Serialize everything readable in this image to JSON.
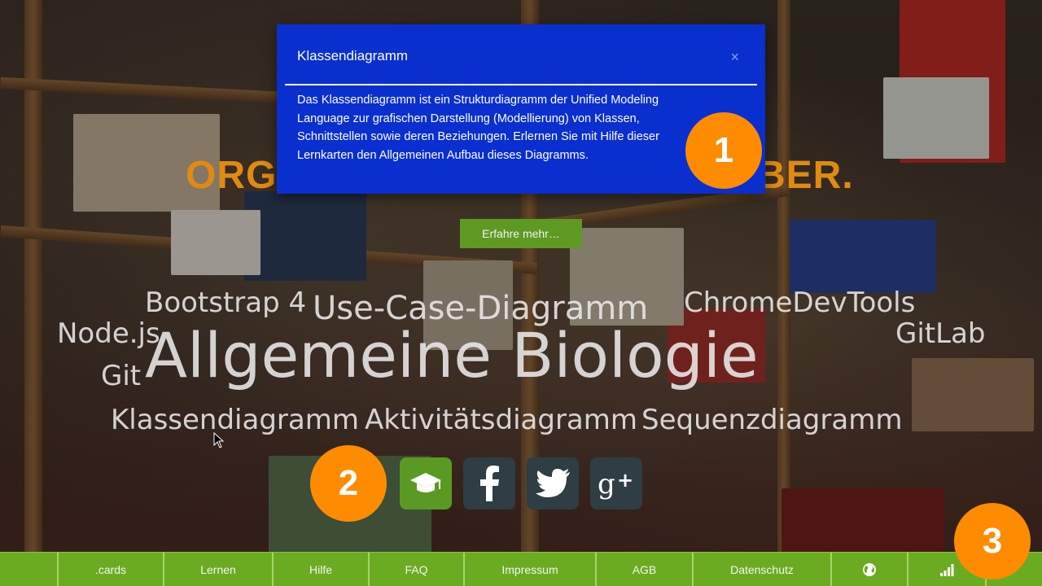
{
  "modal": {
    "title": "Klassendiagramm",
    "close_symbol": "×",
    "body": "Das Klassendiagramm ist ein Strukturdiagramm der Unified Modeling Language zur grafischen Darstellung (Modellierung) von Klassen, Schnittstellen sowie deren Beziehungen. Erlernen Sie mit Hilfe dieser Lernkarten den Allgemeinen Aufbau dieses Diagramms."
  },
  "hero": {
    "headline_left": "ORG",
    "headline_right": "BER.",
    "more_button": "Erfahre mehr…"
  },
  "badges": [
    "1",
    "2",
    "3"
  ],
  "word_cloud": {
    "bootstrap": "Bootstrap 4",
    "usecase": "Use-Case-Diagramm",
    "chromedevtools": "ChromeDevTools",
    "nodejs": "Node.js",
    "gitlab": "GitLab",
    "git": "Git",
    "biologie": "Allgemeine Biologie",
    "klassendiagramm": "Klassendiagramm",
    "aktivitaetsdiagramm": "Aktivitätsdiagramm",
    "sequenzdiagramm": "Sequenzdiagramm"
  },
  "social": [
    "graduation-cap-icon",
    "facebook-icon",
    "twitter-icon",
    "google-plus-icon"
  ],
  "footer": {
    "cards": ".cards",
    "lernen": "Lernen",
    "hilfe": "Hilfe",
    "faq": "FAQ",
    "impressum": "Impressum",
    "agb": "AGB",
    "datenschutz": "Datenschutz"
  },
  "colors": {
    "modal_bg": "#0a2fcf",
    "badge": "#ff8c00",
    "footer": "#6bab22",
    "headline": "#e08a12",
    "accent_green": "#5e9a22"
  }
}
